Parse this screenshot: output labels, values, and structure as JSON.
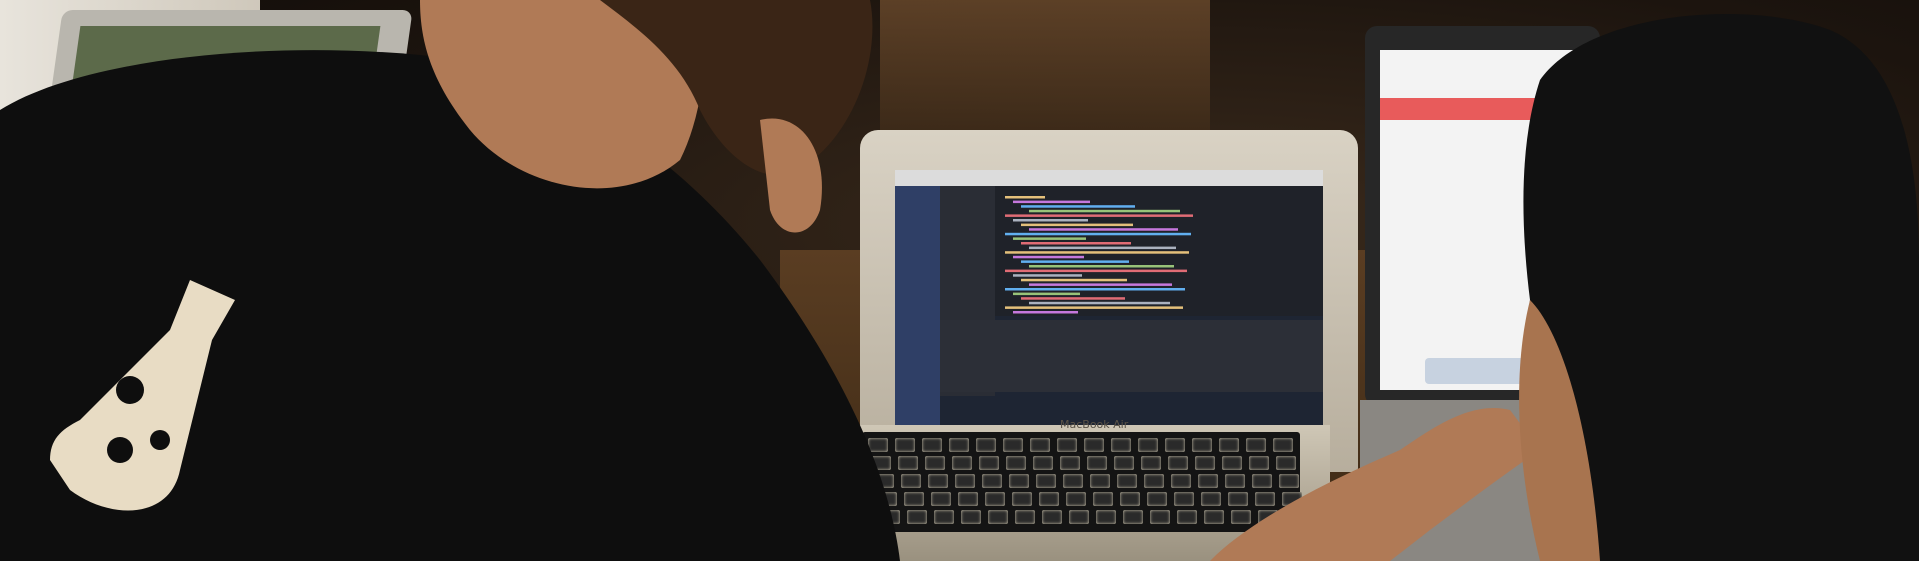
{
  "scene": {
    "description_free": true,
    "laptop_brand": "MacBook Air"
  },
  "colors": {
    "shirt": "#0e0e0e",
    "logo": "#e8dcc4",
    "skin": "#b07a56",
    "hair": "#1a1410",
    "screen_bg": "#1e2533",
    "browser_accent": "#e85b5b"
  }
}
